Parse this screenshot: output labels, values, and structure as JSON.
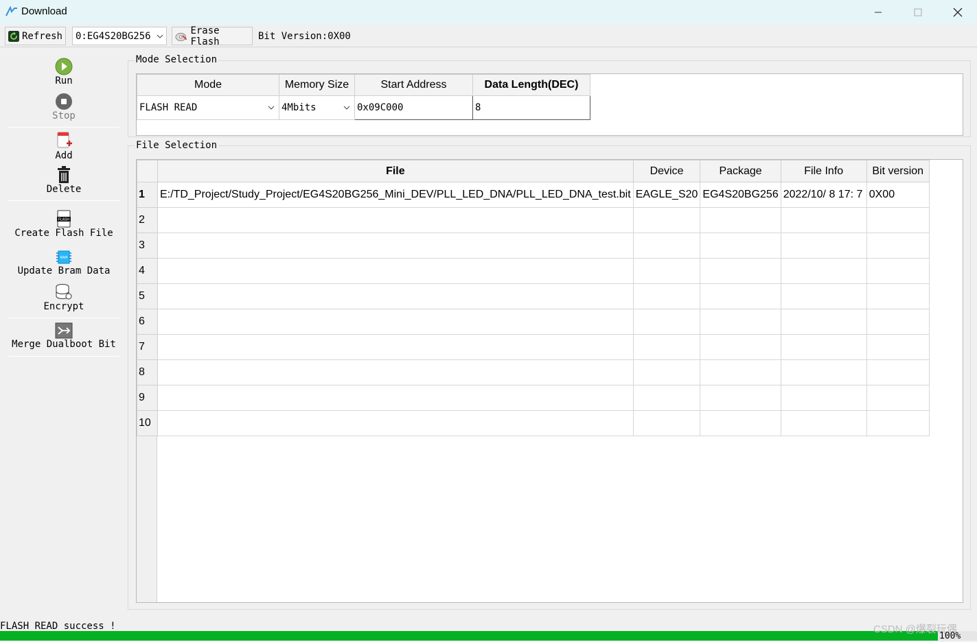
{
  "window": {
    "title": "Download",
    "controls": [
      "minimize",
      "maximize",
      "close"
    ]
  },
  "toolbar": {
    "refresh_label": "Refresh",
    "device_value": "0:EG4S20BG256",
    "erase_label": "Erase Flash",
    "bit_version": "Bit Version:0X00"
  },
  "sidebar": {
    "run": "Run",
    "stop": "Stop",
    "add": "Add",
    "delete": "Delete",
    "create_flash_file": "Create Flash File",
    "update_bram_data": "Update Bram Data",
    "encrypt": "Encrypt",
    "merge_dualboot_bit": "Merge Dualboot Bit"
  },
  "mode_selection": {
    "title": "Mode Selection",
    "headers": [
      "Mode",
      "Memory Size",
      "Start Address",
      "Data Length(DEC)"
    ],
    "mode_value": "FLASH READ",
    "memory_size_value": "4Mbits",
    "start_address_value": "0x09C000",
    "data_length_value": "8"
  },
  "file_selection": {
    "title": "File Selection",
    "headers": [
      "File",
      "Device",
      "Package",
      "File Info",
      "Bit version"
    ],
    "rows": [
      {
        "num": "1",
        "file": "E:/TD_Project/Study_Project/EG4S20BG256_Mini_DEV/PLL_LED_DNA/PLL_LED_DNA_test.bit",
        "device": "EAGLE_S20",
        "package": "EG4S20BG256",
        "info": "2022/10/ 8 17: 7",
        "bitver": "0X00"
      },
      {
        "num": "2",
        "file": "",
        "device": "",
        "package": "",
        "info": "",
        "bitver": ""
      },
      {
        "num": "3",
        "file": "",
        "device": "",
        "package": "",
        "info": "",
        "bitver": ""
      },
      {
        "num": "4",
        "file": "",
        "device": "",
        "package": "",
        "info": "",
        "bitver": ""
      },
      {
        "num": "5",
        "file": "",
        "device": "",
        "package": "",
        "info": "",
        "bitver": ""
      },
      {
        "num": "6",
        "file": "",
        "device": "",
        "package": "",
        "info": "",
        "bitver": ""
      },
      {
        "num": "7",
        "file": "",
        "device": "",
        "package": "",
        "info": "",
        "bitver": ""
      },
      {
        "num": "8",
        "file": "",
        "device": "",
        "package": "",
        "info": "",
        "bitver": ""
      },
      {
        "num": "9",
        "file": "",
        "device": "",
        "package": "",
        "info": "",
        "bitver": ""
      },
      {
        "num": "10",
        "file": "",
        "device": "",
        "package": "",
        "info": "",
        "bitver": ""
      }
    ]
  },
  "status": {
    "message": "FLASH READ success !",
    "progress_percent": 96,
    "progress_label": "100%"
  },
  "watermark": "CSDN @爆裂玩偶",
  "colors": {
    "titlebar": "#e6f5f7",
    "progress": "#06b025",
    "run_icon": "#7cb342"
  },
  "icons": [
    "app-icon",
    "refresh-icon",
    "erase-icon",
    "run-icon",
    "stop-icon",
    "add-icon",
    "delete-icon",
    "flash-file-icon",
    "bram-icon",
    "encrypt-icon",
    "merge-icon"
  ]
}
